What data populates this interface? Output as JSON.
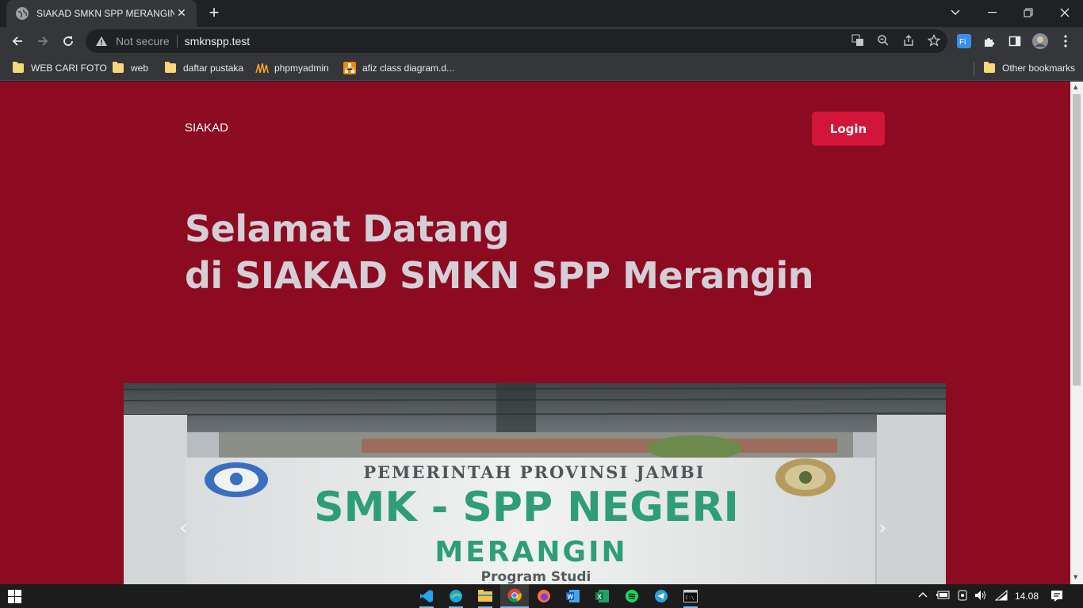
{
  "browser": {
    "tab_title": "SIAKAD SMKN SPP MERANGIN",
    "new_tab_label": "+",
    "security_label": "Not secure",
    "url": "smknspp.test",
    "bookmarks": [
      {
        "label": "WEB CARI FOTO",
        "icon": "folder-icon"
      },
      {
        "label": "web",
        "icon": "folder-icon"
      },
      {
        "label": "daftar pustaka",
        "icon": "folder-icon"
      },
      {
        "label": "phpmyadmin",
        "icon": "phpmyadmin-icon"
      },
      {
        "label": "afiz class diagram.d...",
        "icon": "diagram-icon"
      }
    ],
    "other_bookmarks": "Other bookmarks"
  },
  "page": {
    "brand": "SIAKAD",
    "login_label": "Login",
    "hero_line1": "Selamat Datang",
    "hero_line2": "di SIAKAD SMKN SPP Merangin",
    "carousel": {
      "sign_line1": "PEMERINTAH PROVINSI JAMBI",
      "sign_line2": "SMK - SPP NEGERI",
      "sign_line3": "MERANGIN",
      "sign_line4": "Program Studi",
      "prev_label": "‹",
      "next_label": "›"
    }
  },
  "taskbar": {
    "clock": "14.08"
  },
  "colors": {
    "page_bg": "#8c0b21",
    "login_bg": "#d3153a",
    "hero_text": "#d4cfd6",
    "sign_green": "#2e9e78"
  }
}
